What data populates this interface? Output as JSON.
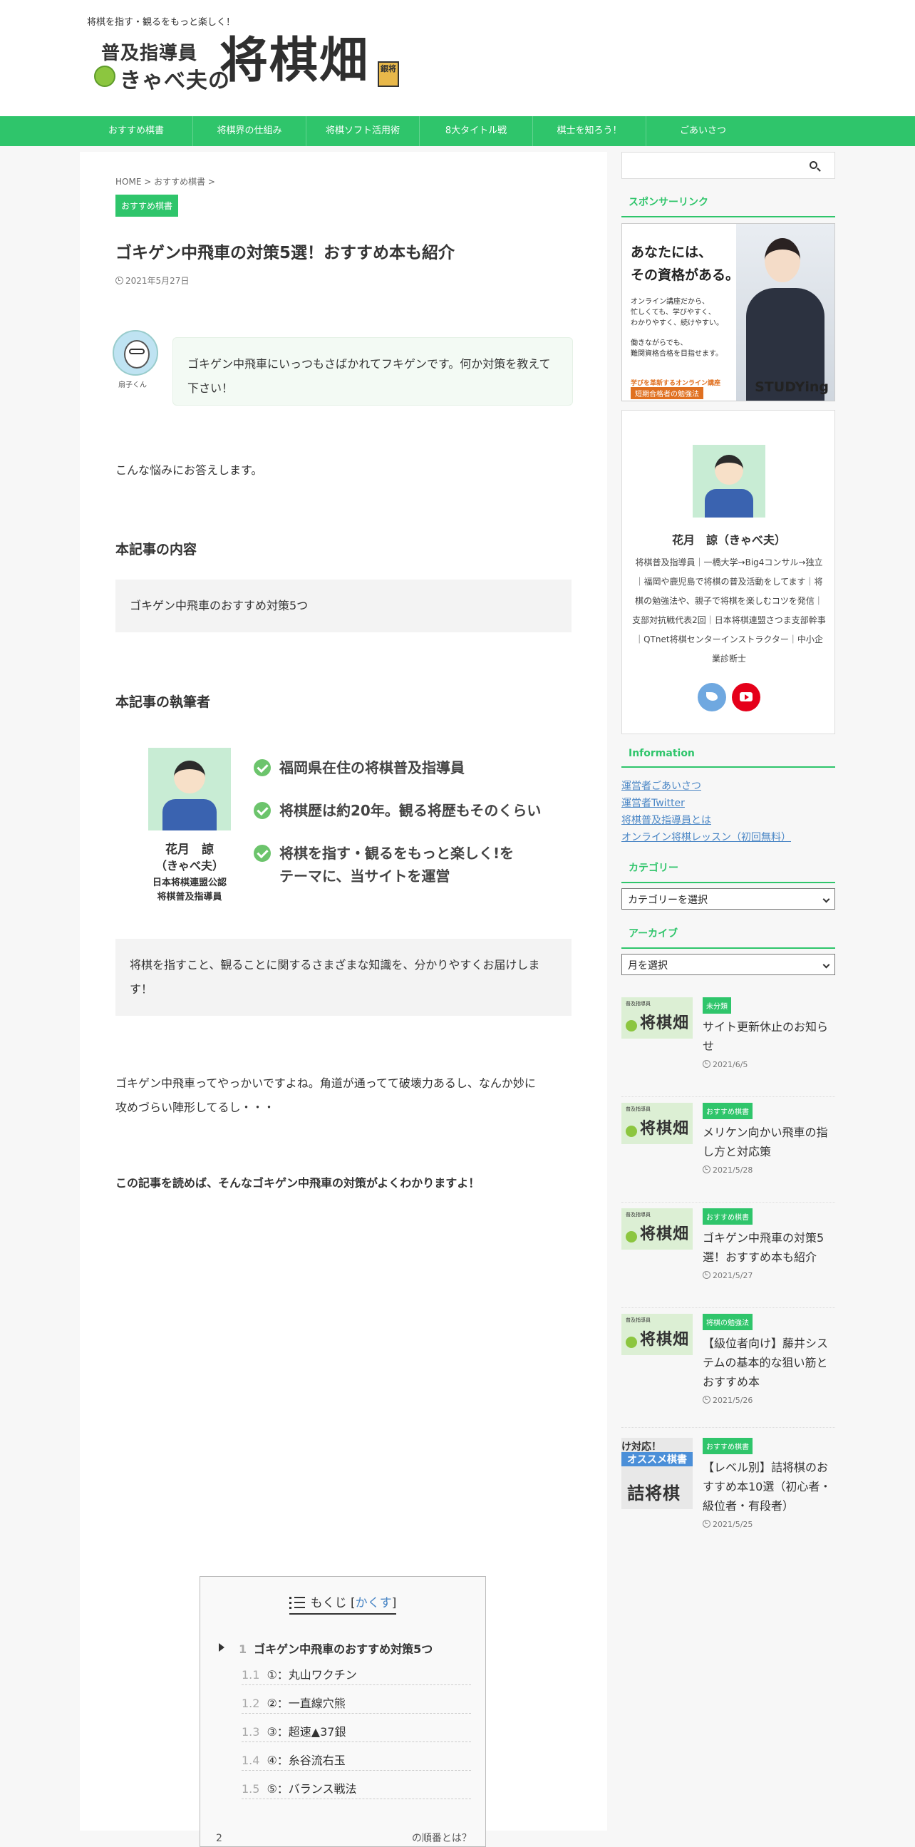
{
  "header": {
    "tagline": "将棋を指す・観るをもっと楽しく！",
    "logo_line1": "普及指導員",
    "logo_line2": "きゃべ夫の",
    "logo_big": "将棋畑",
    "logo_stamp": "銀将"
  },
  "nav": {
    "items": [
      {
        "label": "おすすめ棋書"
      },
      {
        "label": "将棋界の仕組み"
      },
      {
        "label": "将棋ソフト活用術"
      },
      {
        "label": "8大タイトル戦"
      },
      {
        "label": "棋士を知ろう！"
      },
      {
        "label": "ごあいさつ"
      }
    ]
  },
  "article": {
    "breadcrumb": "HOME > おすすめ棋書 >",
    "category": "おすすめ棋書",
    "title": "ゴキゲン中飛車の対策5選！おすすめ本も紹介",
    "date": "2021年5月27日",
    "speech_name": "扇子くん",
    "speech_text": "ゴキゲン中飛車にいっつもさばかれてフキゲンです。何か対策を教えて下さい！",
    "intro": "こんな悩みにお答えします。",
    "content_heading": "本記事の内容",
    "content_box": "ゴキゲン中飛車のおすすめ対策5つ",
    "author_heading": "本記事の執筆者",
    "author_name": "花月　諒",
    "author_kana": "（きゃべ夫）",
    "author_title1": "日本将棋連盟公認",
    "author_title2": "将棋普及指導員",
    "checks": [
      {
        "text": "福岡県在住の将棋普及指導員"
      },
      {
        "text": "将棋歴は約20年。観る将歴もそのくらい"
      },
      {
        "text": "将棋を指す・観るをもっと楽しく!を"
      },
      {
        "text": "テーマに、当サイトを運営"
      }
    ],
    "author_box": "将棋を指すこと、観ることに関するさまざまな知識を、分かりやすくお届けします！",
    "para1_line1": "ゴキゲン中飛車ってやっかいですよね。角道が通ってて破壊力あるし、なんか妙に",
    "para1_line2": "攻めづらい陣形してるし・・・",
    "para2": "この記事を読めば、そんなゴキゲン中飛車の対策がよくわかりますよ！"
  },
  "toc": {
    "title": "もくじ",
    "hide_label": "かくす",
    "items": [
      {
        "num": "1",
        "label": "ゴキゲン中飛車のおすすめ対策5つ"
      },
      {
        "num": "1.1",
        "label": "①：丸山ワクチン"
      },
      {
        "num": "1.2",
        "label": "②：一直線穴熊"
      },
      {
        "num": "1.3",
        "label": "③：超速▲37銀"
      },
      {
        "num": "1.4",
        "label": "④：糸谷流右玉"
      },
      {
        "num": "1.5",
        "label": "⑤：バランス戦法"
      }
    ],
    "next": "2　　　　　　　　　　　　　　　　　　　の順番とは？"
  },
  "sidebar": {
    "search_placeholder": "",
    "sponsor_heading": "スポンサーリンク",
    "ad": {
      "line1": "あなたには、",
      "line2": "その資格がある。",
      "sub1": "オンライン講座だから、",
      "sub2": "忙しくても、学びやすく、",
      "sub3": "わかりやすく、続けやすい。",
      "sub4": "働きながらでも、",
      "sub5": "難関資格合格を目指せます。",
      "footer1": "学びを革新するオンライン講座",
      "footer2": "短期合格者の勉強法",
      "logo": "STUDYing"
    },
    "profile": {
      "name": "花月　諒（きゃべ夫）",
      "bio": "将棋普及指導員｜一橋大学→Big4コンサル→独立｜福岡や鹿児島で将棋の普及活動をしてます｜将棋の勉強法や、親子で将棋を楽しむコツを発信｜支部対抗戦代表2回｜日本将棋連盟さつま支部幹事｜QTnet将棋センターインストラクター｜中小企業診断士",
      "twitter": "twitter-icon",
      "youtube": "youtube-icon"
    },
    "info_heading": "Information",
    "info_links": [
      {
        "label": "運営者ごあいさつ"
      },
      {
        "label": "運営者Twitter"
      },
      {
        "label": "将棋普及指導員とは"
      },
      {
        "label": "オンライン将棋レッスン（初回無料）"
      }
    ],
    "category_heading": "カテゴリー",
    "category_select": "カテゴリーを選択",
    "archive_heading": "アーカイブ",
    "archive_select": "月を選択",
    "recent": [
      {
        "cat": "未分類",
        "title": "サイト更新休止のお知らせ",
        "date": "2021/6/5"
      },
      {
        "cat": "おすすめ棋書",
        "title": "メリケン向かい飛車の指し方と対応策",
        "date": "2021/5/28"
      },
      {
        "cat": "おすすめ棋書",
        "title": "ゴキゲン中飛車の対策5選！おすすめ本も紹介",
        "date": "2021/5/27"
      },
      {
        "cat": "将棋の勉強法",
        "title": "【級位者向け】藤井システムの基本的な狙い筋とおすすめ本",
        "date": "2021/5/26"
      },
      {
        "cat": "おすすめ棋書",
        "title": "【レベル別】詰将棋のおすすめ本10選（初心者・級位者・有段者）",
        "date": "2021/5/25"
      }
    ],
    "thumb_small": "普及指導員",
    "thumb_big": "将棋畑",
    "thumb_alt_top": "け対応！",
    "thumb_alt_mid": "オススメ棋書",
    "thumb_alt_big": "詰将棋"
  },
  "colors": {
    "accent": "#2fc56b",
    "link": "#4a86c5"
  }
}
